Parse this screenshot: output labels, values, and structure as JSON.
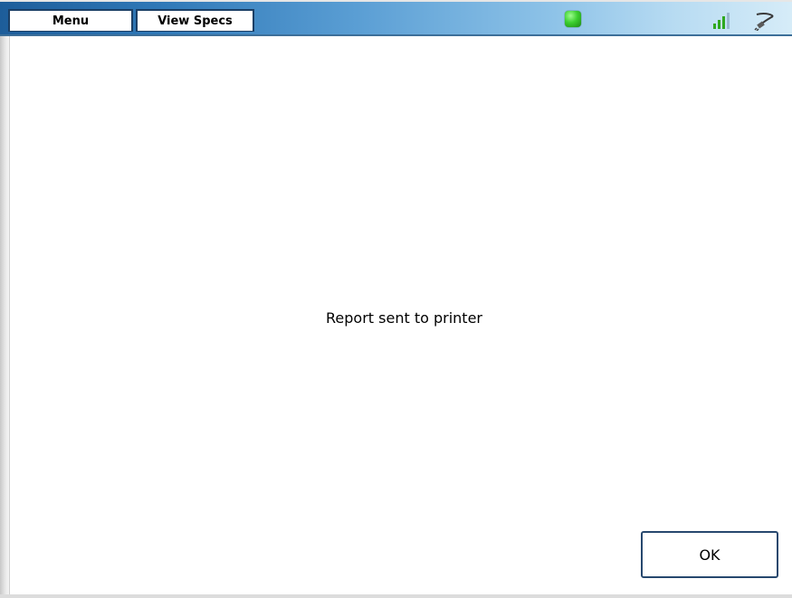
{
  "top_bar": {
    "menu_label": "Menu",
    "view_specs_label": "View Specs",
    "status_icon": "green-status-led-icon",
    "signal_icon": "signal-strength-icon",
    "connection_icon": "plug-cable-icon",
    "colors": {
      "bar_dark": "#1d5d9a",
      "bar_light": "#d6ecf8",
      "led_green": "#3ccf2f",
      "signal_green": "#2fa81f"
    }
  },
  "dialog": {
    "message": "Report sent to printer",
    "ok_label": "OK"
  }
}
